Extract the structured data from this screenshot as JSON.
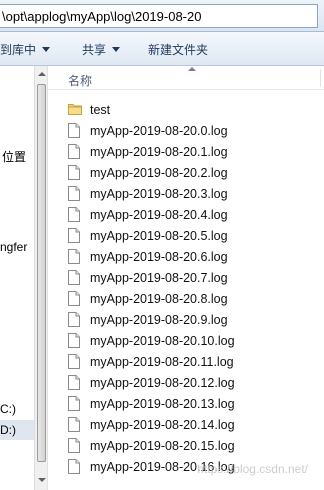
{
  "address": {
    "path": "\\opt\\applog\\myApp\\log\\2019-08-20"
  },
  "toolbar": {
    "include_label": "到库中",
    "share_label": "共享",
    "new_folder_label": "新建文件夹"
  },
  "nav": {
    "items": [
      {
        "label": "位置"
      },
      {
        "label": "ngfer"
      },
      {
        "label": "C:)"
      },
      {
        "label": "D:)"
      }
    ]
  },
  "columns": {
    "name": "名称"
  },
  "files": [
    {
      "name": "test",
      "icon": "folder-icon"
    },
    {
      "name": "myApp-2019-08-20.0.log",
      "icon": "document-icon"
    },
    {
      "name": "myApp-2019-08-20.1.log",
      "icon": "document-icon"
    },
    {
      "name": "myApp-2019-08-20.2.log",
      "icon": "document-icon"
    },
    {
      "name": "myApp-2019-08-20.3.log",
      "icon": "document-icon"
    },
    {
      "name": "myApp-2019-08-20.4.log",
      "icon": "document-icon"
    },
    {
      "name": "myApp-2019-08-20.5.log",
      "icon": "document-icon"
    },
    {
      "name": "myApp-2019-08-20.6.log",
      "icon": "document-icon"
    },
    {
      "name": "myApp-2019-08-20.7.log",
      "icon": "document-icon"
    },
    {
      "name": "myApp-2019-08-20.8.log",
      "icon": "document-icon"
    },
    {
      "name": "myApp-2019-08-20.9.log",
      "icon": "document-icon"
    },
    {
      "name": "myApp-2019-08-20.10.log",
      "icon": "document-icon"
    },
    {
      "name": "myApp-2019-08-20.11.log",
      "icon": "document-icon"
    },
    {
      "name": "myApp-2019-08-20.12.log",
      "icon": "document-icon"
    },
    {
      "name": "myApp-2019-08-20.13.log",
      "icon": "document-icon"
    },
    {
      "name": "myApp-2019-08-20.14.log",
      "icon": "document-icon"
    },
    {
      "name": "myApp-2019-08-20.15.log",
      "icon": "document-icon"
    },
    {
      "name": "myApp-2019-08-20.16.log",
      "icon": "document-icon"
    }
  ],
  "watermark": "https://blog.csdn.net/"
}
